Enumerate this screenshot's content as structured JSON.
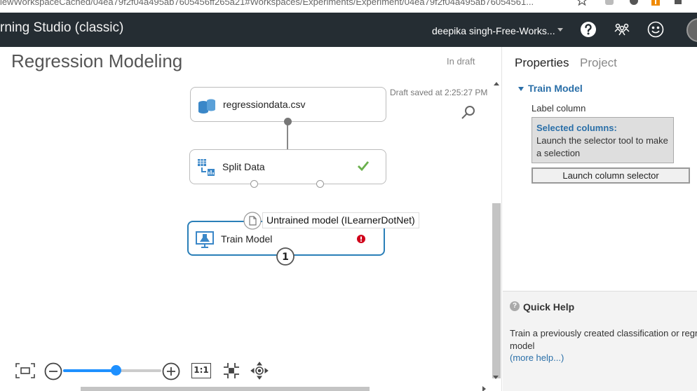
{
  "browser": {
    "url": "iewWorkspaceCached/04ea79f2f04a495ab7605456ff265a21#Workspaces/Experiments/Experiment/04ea79f2f04a495ab76054561...",
    "star_icon": "star-icon",
    "extension_icons": [
      "extension-gray-icon",
      "extension-dark-icon",
      "extension-orange-icon",
      "puzzle-icon"
    ]
  },
  "header": {
    "brand": "rning Studio (classic)",
    "user": "deepika singh-Free-Works...",
    "icons": [
      "help-icon",
      "community-icon",
      "feedback-smiley-icon",
      "avatar"
    ]
  },
  "canvas": {
    "title": "Regression Modeling",
    "status": "In draft",
    "saved": "Draft saved at 2:25:27 PM",
    "modules": {
      "dataset": {
        "label": "regressiondata.csv",
        "icon": "database-icon"
      },
      "split": {
        "label": "Split Data",
        "icon": "split-data-icon",
        "state_icon": "checkmark-icon"
      },
      "train": {
        "label": "Train Model",
        "icon": "train-model-icon",
        "state_icon": "error-icon",
        "badge": "1"
      }
    },
    "tooltip": "Untrained model (ILearnerDotNet)",
    "toolbar": [
      "fit-to-screen-icon",
      "zoom-out-icon",
      "zoom-slider",
      "zoom-in-icon",
      "actual-size-icon",
      "minimap-icon",
      "pan-icon"
    ],
    "zoom_level": 0.54,
    "actual_size_label": "1:1",
    "accent": "#1e90ff"
  },
  "properties": {
    "tab_active": "Properties",
    "tab_inactive": "Project",
    "section": "Train Model",
    "field_label": "Label column",
    "selected_title": "Selected columns:",
    "selected_text": "Launch the selector tool to make a selection",
    "launch_button": "Launch column selector"
  },
  "quick_help": {
    "title": "Quick Help",
    "text": "Train a previously created classification or regre model",
    "link": "(more help...)"
  }
}
